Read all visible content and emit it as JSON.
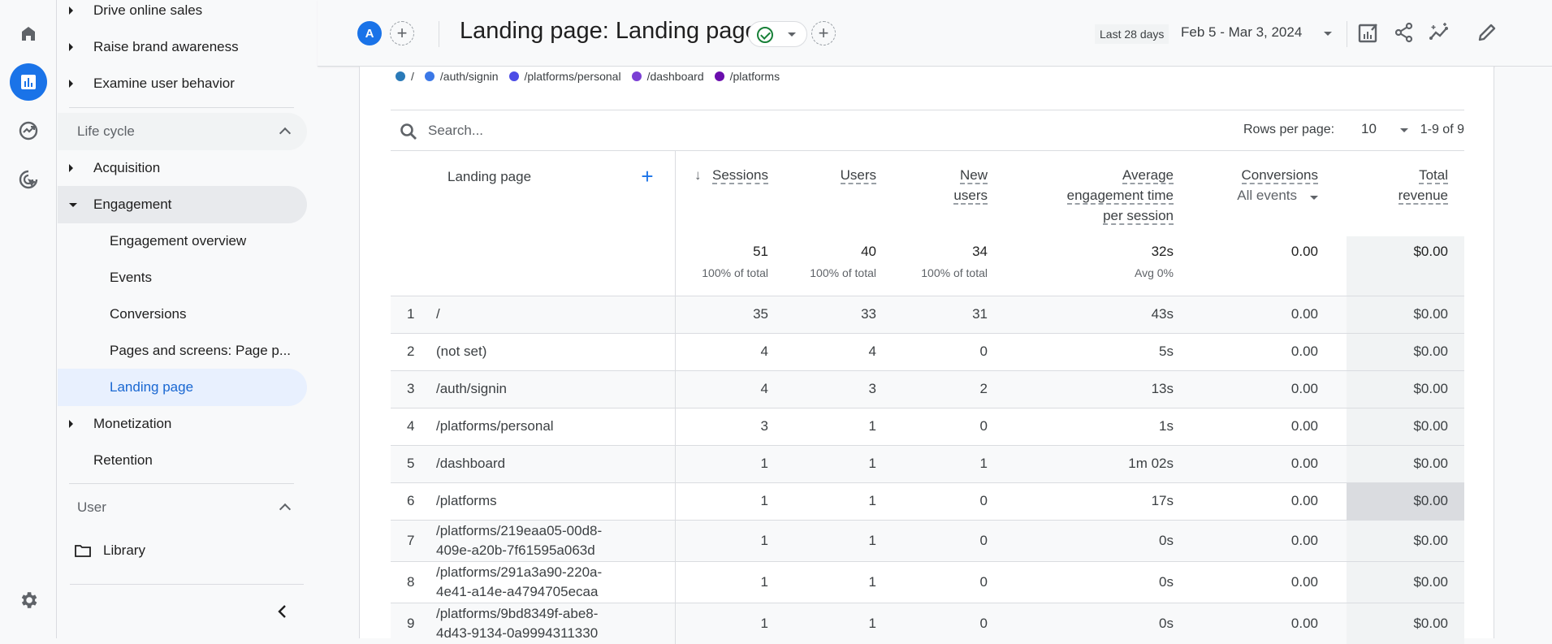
{
  "rail": {
    "items": [
      {
        "icon": "home-icon",
        "label": "Home"
      },
      {
        "icon": "reports-icon",
        "label": "Reports",
        "active": true
      },
      {
        "icon": "explore-icon",
        "label": "Explore"
      },
      {
        "icon": "advertising-icon",
        "label": "Advertising"
      }
    ],
    "settings_icon": "gear-icon"
  },
  "nav": {
    "items": [
      {
        "label": "Drive online sales",
        "type": "collapsible"
      },
      {
        "label": "Raise brand awareness",
        "type": "collapsible"
      },
      {
        "label": "Examine user behavior",
        "type": "collapsible"
      },
      {
        "label": "Life cycle",
        "type": "section"
      },
      {
        "label": "Acquisition",
        "type": "collapsible"
      },
      {
        "label": "Engagement",
        "type": "expanded"
      },
      {
        "label": "Engagement overview",
        "type": "sub"
      },
      {
        "label": "Events",
        "type": "sub"
      },
      {
        "label": "Conversions",
        "type": "sub"
      },
      {
        "label": "Pages and screens: Page p...",
        "type": "sub"
      },
      {
        "label": "Landing page",
        "type": "sub",
        "selected": true
      },
      {
        "label": "Monetization",
        "type": "collapsible"
      },
      {
        "label": "Retention",
        "type": "leaf"
      },
      {
        "label": "User",
        "type": "section"
      },
      {
        "label": "Library",
        "type": "library"
      }
    ]
  },
  "header": {
    "avatar_letter": "A",
    "title": "Landing page: Landing page",
    "date_chip": "Last 28 days",
    "date_range": "Feb 5 - Mar 3, 2024"
  },
  "legend": [
    {
      "label": "/",
      "color": "#2a7ab8"
    },
    {
      "label": "/auth/signin",
      "color": "#3b78e7"
    },
    {
      "label": "/platforms/personal",
      "color": "#4c4ce6"
    },
    {
      "label": "/dashboard",
      "color": "#7b3fd4"
    },
    {
      "label": "/platforms",
      "color": "#6a0dad"
    }
  ],
  "table": {
    "search_placeholder": "Search...",
    "rows_per_page_label": "Rows per page:",
    "rows_per_page": "10",
    "pager": "1-9 of 9",
    "columns": {
      "dimension": "Landing page",
      "sessions": "Sessions",
      "users": "Users",
      "new_users_1": "New",
      "new_users_2": "users",
      "avg_eng_1": "Average",
      "avg_eng_2": "engagement time",
      "avg_eng_3": "per session",
      "conversions": "Conversions",
      "conversions_filter": "All events",
      "revenue_1": "Total",
      "revenue_2": "revenue"
    },
    "totals": {
      "sessions": "51",
      "sessions_sub": "100% of total",
      "users": "40",
      "users_sub": "100% of total",
      "new_users": "34",
      "new_users_sub": "100% of total",
      "avg_eng": "32s",
      "avg_eng_sub": "Avg 0%",
      "conversions": "0.00",
      "revenue": "$0.00"
    },
    "rows": [
      {
        "idx": "1",
        "page": "/",
        "page2": "",
        "sessions": "35",
        "users": "33",
        "new_users": "31",
        "avg_eng": "43s",
        "conversions": "0.00",
        "revenue": "$0.00"
      },
      {
        "idx": "2",
        "page": "(not set)",
        "page2": "",
        "sessions": "4",
        "users": "4",
        "new_users": "0",
        "avg_eng": "5s",
        "conversions": "0.00",
        "revenue": "$0.00"
      },
      {
        "idx": "3",
        "page": "/auth/signin",
        "page2": "",
        "sessions": "4",
        "users": "3",
        "new_users": "2",
        "avg_eng": "13s",
        "conversions": "0.00",
        "revenue": "$0.00"
      },
      {
        "idx": "4",
        "page": "/platforms/personal",
        "page2": "",
        "sessions": "3",
        "users": "1",
        "new_users": "0",
        "avg_eng": "1s",
        "conversions": "0.00",
        "revenue": "$0.00"
      },
      {
        "idx": "5",
        "page": "/dashboard",
        "page2": "",
        "sessions": "1",
        "users": "1",
        "new_users": "1",
        "avg_eng": "1m 02s",
        "conversions": "0.00",
        "revenue": "$0.00"
      },
      {
        "idx": "6",
        "page": "/platforms",
        "page2": "",
        "sessions": "1",
        "users": "1",
        "new_users": "0",
        "avg_eng": "17s",
        "conversions": "0.00",
        "revenue": "$0.00"
      },
      {
        "idx": "7",
        "page": "/platforms/219eaa05-00d8-",
        "page2": "409e-a20b-7f61595a063d",
        "sessions": "1",
        "users": "1",
        "new_users": "0",
        "avg_eng": "0s",
        "conversions": "0.00",
        "revenue": "$0.00"
      },
      {
        "idx": "8",
        "page": "/platforms/291a3a90-220a-",
        "page2": "4e41-a14e-a4794705ecaa",
        "sessions": "1",
        "users": "1",
        "new_users": "0",
        "avg_eng": "0s",
        "conversions": "0.00",
        "revenue": "$0.00"
      },
      {
        "idx": "9",
        "page": "/platforms/9bd8349f-abe8-",
        "page2": "4d43-9134-0a9994311330",
        "sessions": "1",
        "users": "1",
        "new_users": "0",
        "avg_eng": "0s",
        "conversions": "0.00",
        "revenue": "$0.00"
      }
    ]
  }
}
